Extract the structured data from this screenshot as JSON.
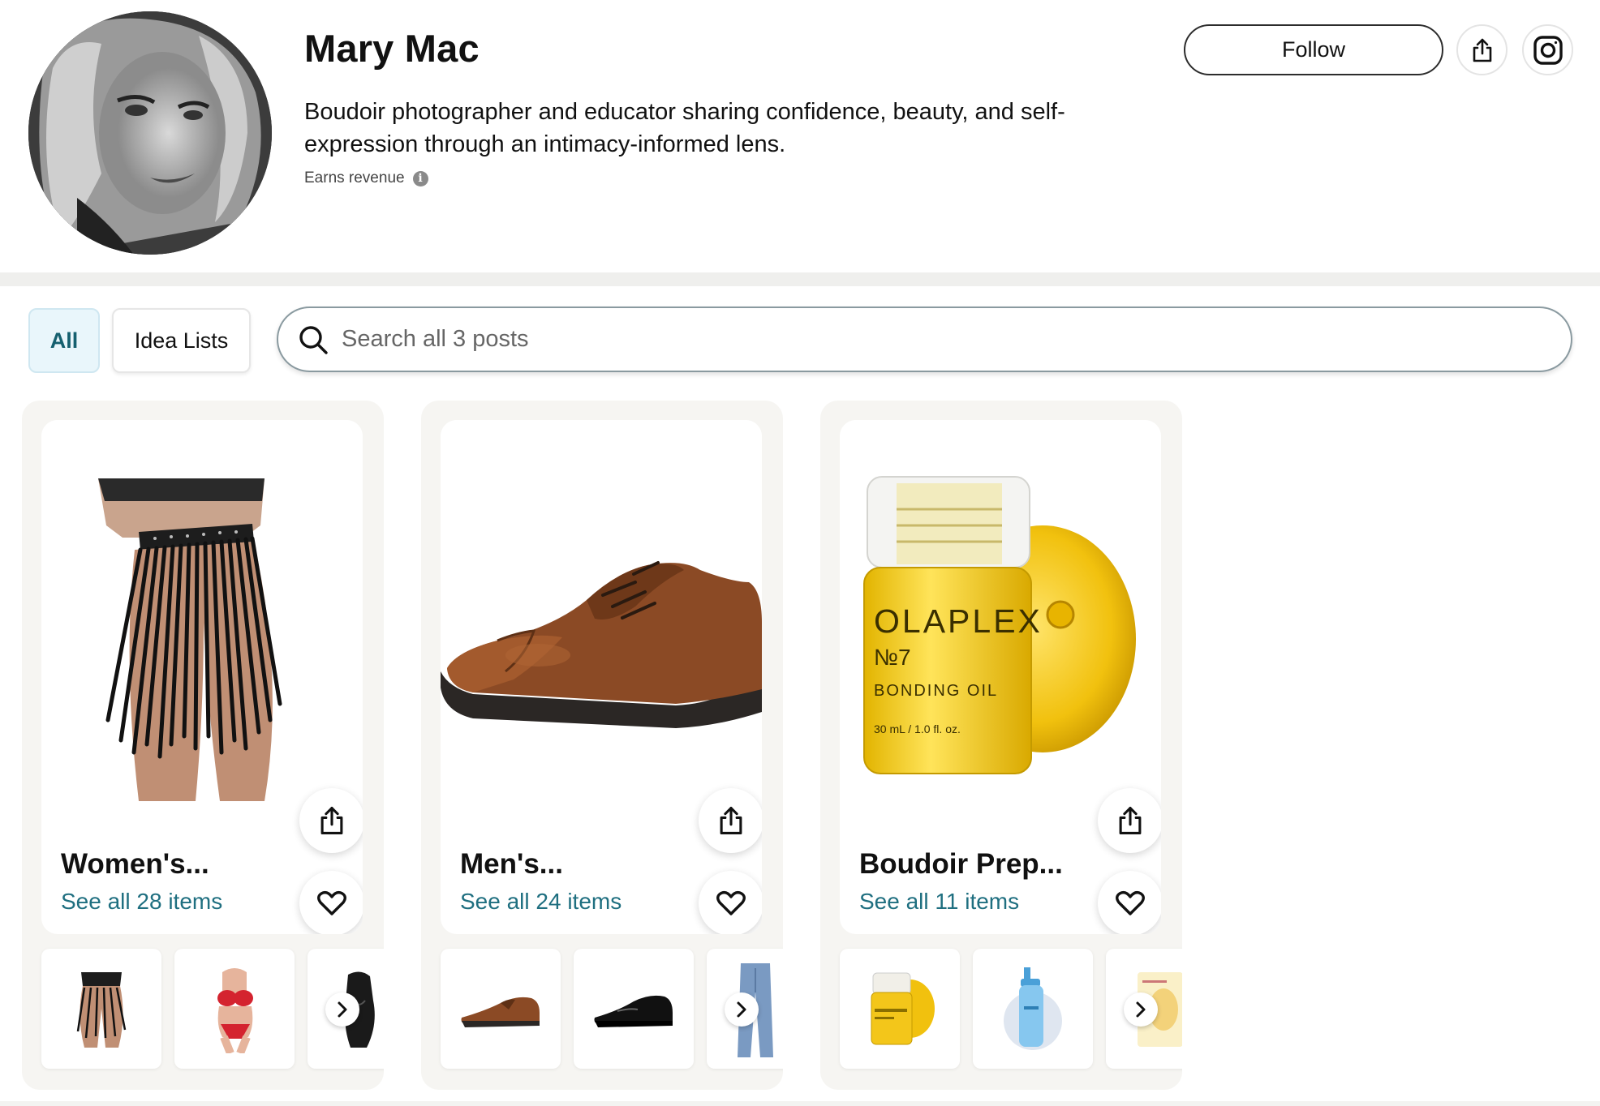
{
  "profile": {
    "name": "Mary Mac",
    "bio": "Boudoir photographer and educator sharing confidence, beauty, and self-expression through an intimacy-informed lens.",
    "earns_label": "Earns revenue",
    "info_icon": "info-icon",
    "follow_label": "Follow",
    "share_icon": "share-icon",
    "social_icon": "instagram-icon"
  },
  "filters": {
    "tabs": [
      {
        "label": "All",
        "active": true
      },
      {
        "label": "Idea Lists",
        "active": false
      }
    ],
    "search_placeholder": "Search all 3 posts",
    "search_icon": "search-icon"
  },
  "cards": [
    {
      "title": "Women's...",
      "link": "See all 28 items",
      "image": "leather-fringe-skirt",
      "thumbnails": [
        "fringe-skirt",
        "red-lingerie",
        "black-bodysuit"
      ]
    },
    {
      "title": "Men's...",
      "link": "See all 24 items",
      "image": "brown-oxford-shoe",
      "thumbnails": [
        "brown-shoe",
        "black-shoe",
        "jeans"
      ]
    },
    {
      "title": "Boudoir Prep...",
      "link": "See all 11 items",
      "image": "olaplex-bonding-oil",
      "thumbnails": [
        "olaplex-bottle",
        "blue-cleanser",
        "eye-patches"
      ]
    }
  ],
  "product_label": {
    "brand": "OLAPLEX",
    "number": "№7",
    "product": "BONDING OIL",
    "size": "30 mL / 1.0 fl. oz."
  },
  "colors": {
    "accent_link": "#1f6f80",
    "active_tab_bg": "#e9f6fb",
    "card_bg": "#f6f5f2"
  }
}
